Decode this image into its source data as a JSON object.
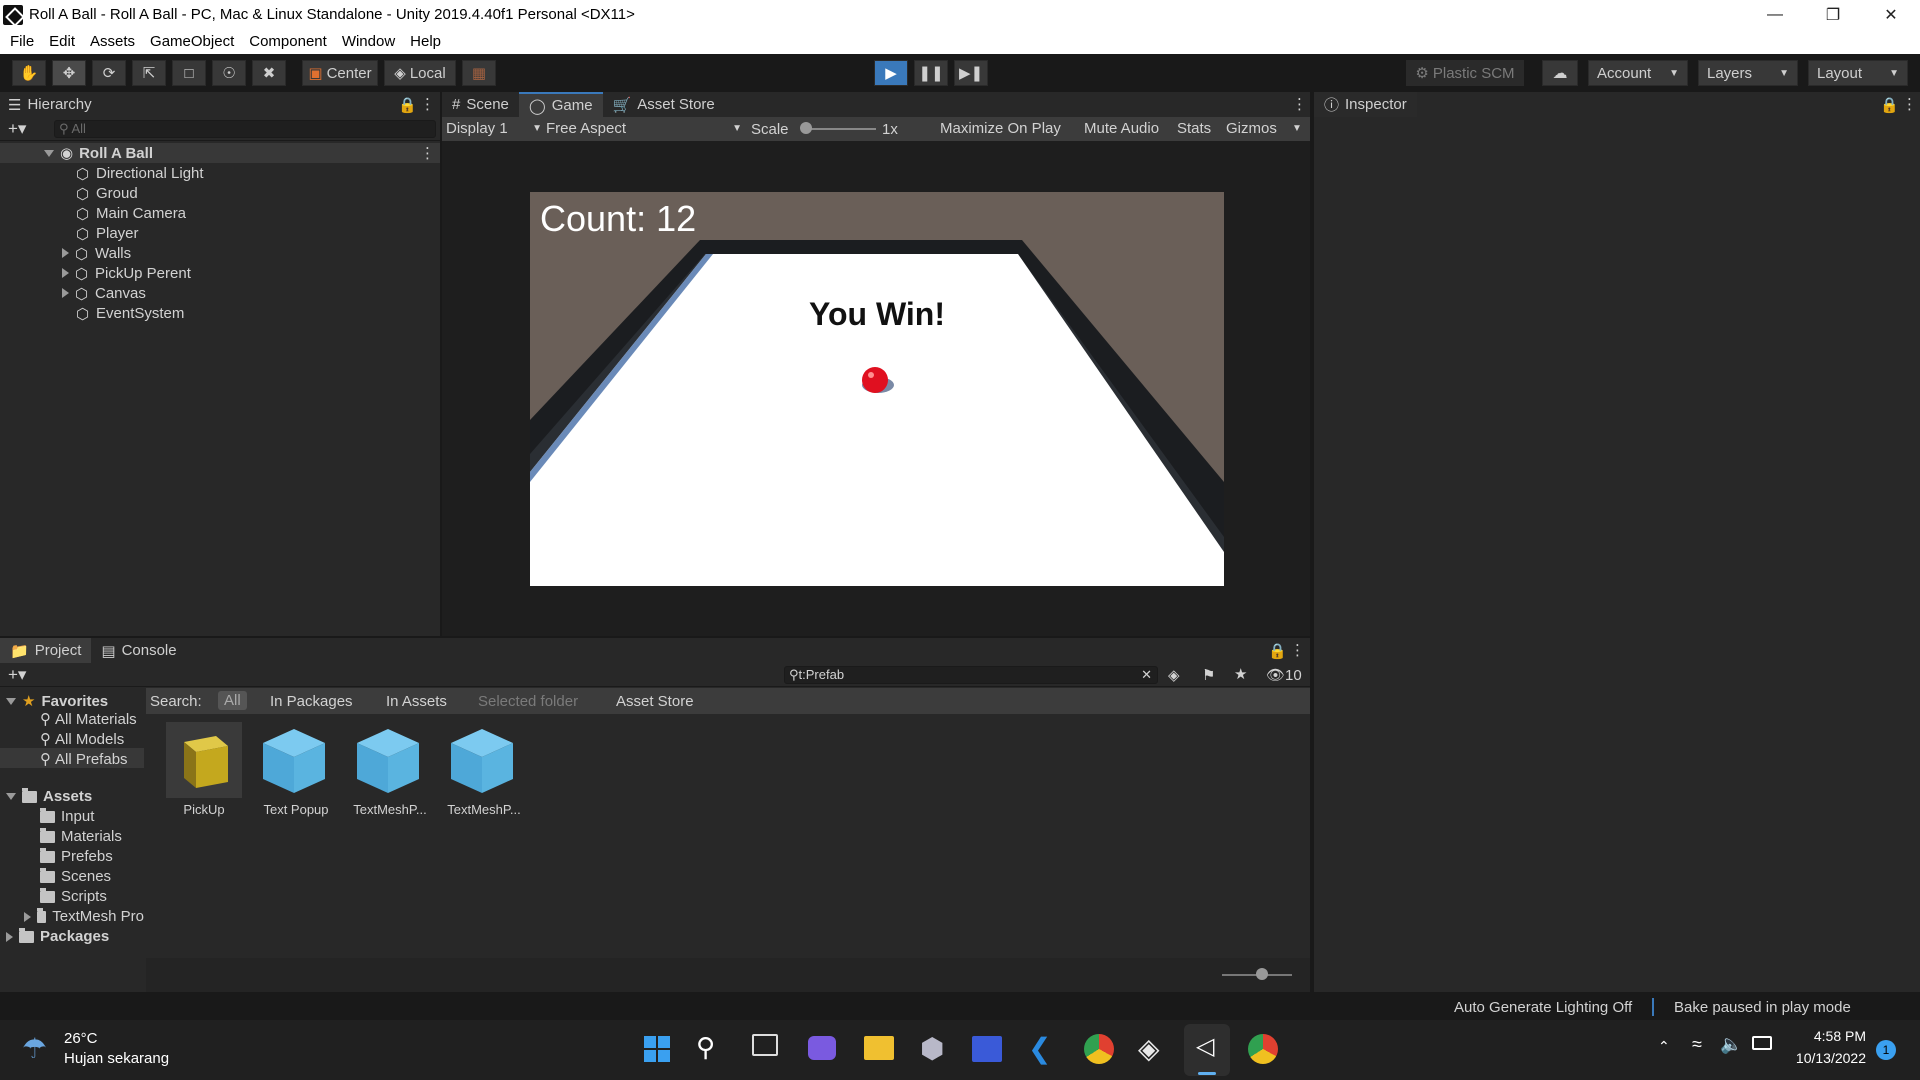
{
  "window": {
    "title": "Roll A Ball - Roll A Ball - PC, Mac & Linux Standalone - Unity 2019.4.40f1 Personal <DX11>"
  },
  "menu": [
    "File",
    "Edit",
    "Assets",
    "GameObject",
    "Component",
    "Window",
    "Help"
  ],
  "toolbar": {
    "center_label": "Center",
    "local_label": "Local",
    "plastic_label": "Plastic SCM",
    "account_label": "Account",
    "layers_label": "Layers",
    "layout_label": "Layout"
  },
  "hierarchy": {
    "tab": "Hierarchy",
    "search_placeholder": "All",
    "scene": "Roll A Ball",
    "items": [
      "Directional Light",
      "Groud",
      "Main Camera",
      "Player",
      "Walls",
      "PickUp Perent",
      "Canvas",
      "EventSystem"
    ]
  },
  "game_view": {
    "tabs": [
      "Scene",
      "Game",
      "Asset Store"
    ],
    "display": "Display 1",
    "aspect": "Free Aspect",
    "scale_label": "Scale",
    "scale_value": "1x",
    "options": [
      "Maximize On Play",
      "Mute Audio",
      "Stats",
      "Gizmos"
    ],
    "count_text": "Count: 12",
    "win_text": "You Win!"
  },
  "inspector": {
    "tab": "Inspector"
  },
  "project": {
    "tabs": [
      "Project",
      "Console"
    ],
    "search_value": "t:Prefab",
    "hidden_count": "10",
    "search_label": "Search:",
    "filters": [
      "All",
      "In Packages",
      "In Assets",
      "Selected folder",
      "Asset Store"
    ],
    "favorites_label": "Favorites",
    "favorites": [
      "All Materials",
      "All Models",
      "All Prefabs"
    ],
    "assets_label": "Assets",
    "asset_folders": [
      "Input",
      "Materials",
      "Prefebs",
      "Scenes",
      "Scripts",
      "TextMesh Pro"
    ],
    "packages_label": "Packages",
    "prefabs": [
      "PickUp",
      "Text Popup",
      "TextMeshP...",
      "TextMeshP..."
    ]
  },
  "status": {
    "lighting": "Auto Generate Lighting Off",
    "bake": "Bake paused in play mode"
  },
  "taskbar": {
    "temperature": "26°C",
    "weather": "Hujan sekarang",
    "time": "4:58 PM",
    "date": "10/13/2022",
    "notification_count": "1"
  },
  "colors": {
    "accent": "#3a79bb",
    "ball": "#e01020",
    "pickup_cube": "#c4a81e",
    "prefab_blue": "#5ab4e0"
  }
}
